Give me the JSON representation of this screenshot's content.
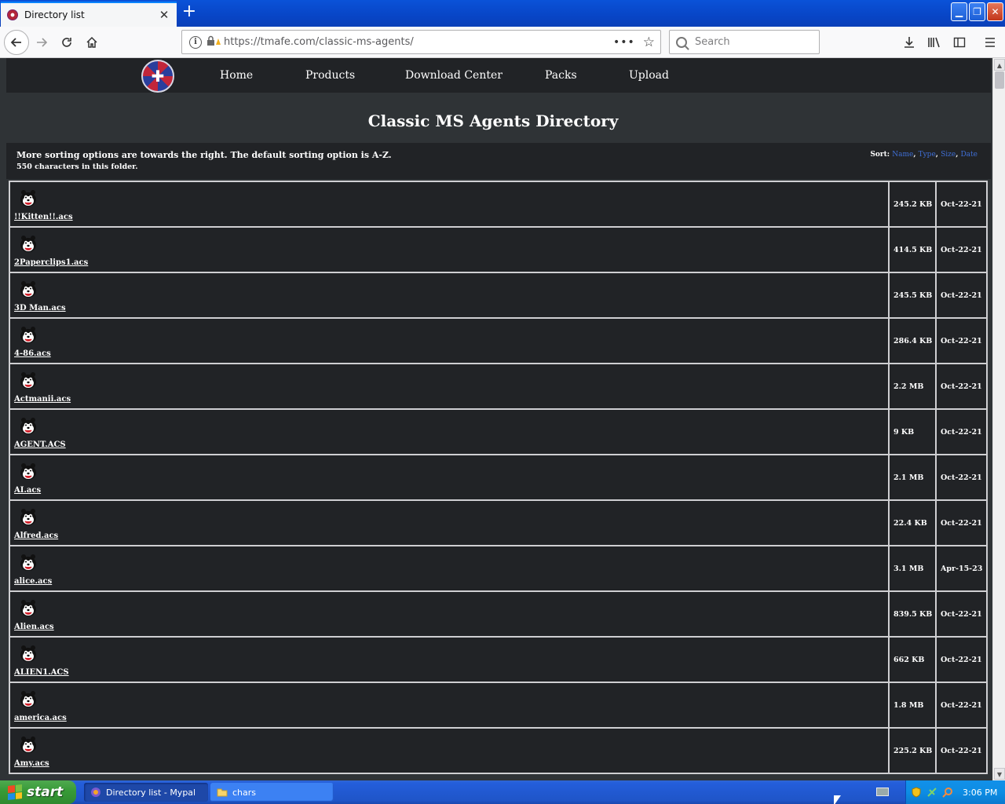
{
  "browser": {
    "tab_title": "Directory list",
    "tab_close": "✕",
    "new_tab": "+",
    "url": "https://tmafe.com/classic-ms-agents/",
    "url_more": "•••",
    "search_placeholder": "Search",
    "window_buttons": {
      "minimize": "▁",
      "restore": "❐",
      "close": "✕"
    }
  },
  "site": {
    "nav": [
      "Home",
      "Products",
      "Download Center",
      "Packs",
      "Upload"
    ],
    "title": "Classic MS Agents Directory",
    "info_line1": "More sorting options are towards the right. The default sorting option is A-Z.",
    "info_line2": "550 characters in this folder.",
    "sort_label": "Sort:",
    "sort_options": [
      "Name",
      "Type",
      "Size",
      "Date"
    ]
  },
  "files": [
    {
      "name": "!!Kitten!!.acs",
      "size": "245.2 KB",
      "date": "Oct-22-21"
    },
    {
      "name": "2Paperclips1.acs",
      "size": "414.5 KB",
      "date": "Oct-22-21"
    },
    {
      "name": "3D Man.acs",
      "size": "245.5 KB",
      "date": "Oct-22-21"
    },
    {
      "name": "4-86.acs",
      "size": "286.4 KB",
      "date": "Oct-22-21"
    },
    {
      "name": "Actmanii.acs",
      "size": "2.2 MB",
      "date": "Oct-22-21"
    },
    {
      "name": "AGENT.ACS",
      "size": "9 KB",
      "date": "Oct-22-21"
    },
    {
      "name": "AI.acs",
      "size": "2.1 MB",
      "date": "Oct-22-21"
    },
    {
      "name": "Alfred.acs",
      "size": "22.4 KB",
      "date": "Oct-22-21"
    },
    {
      "name": "alice.acs",
      "size": "3.1 MB",
      "date": "Apr-15-23"
    },
    {
      "name": "Alien.acs",
      "size": "839.5 KB",
      "date": "Oct-22-21"
    },
    {
      "name": "ALIEN1.ACS",
      "size": "662 KB",
      "date": "Oct-22-21"
    },
    {
      "name": "america.acs",
      "size": "1.8 MB",
      "date": "Oct-22-21"
    },
    {
      "name": "Amy.acs",
      "size": "225.2 KB",
      "date": "Oct-22-21"
    }
  ],
  "taskbar": {
    "start_label": "start",
    "items": [
      {
        "label": "Directory list - Mypal",
        "active": true
      },
      {
        "label": "chars",
        "active": false
      }
    ],
    "clock": "3:06 PM"
  },
  "colors": {
    "page_bg": "#2f3336",
    "panel_bg": "#212326",
    "border": "#cfcfd2",
    "sort_link": "#3f6fd6",
    "taskbar": "#245edb",
    "start_green": "#379a37"
  },
  "icons": {
    "agent_file": "cartoon-face-icon",
    "site_logo": "cross-emblem-icon"
  }
}
